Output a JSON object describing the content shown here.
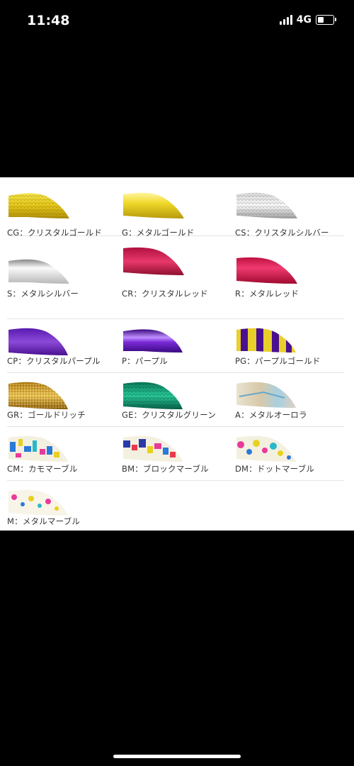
{
  "status": {
    "time": "11:48",
    "network": "4G"
  },
  "colors": [
    {
      "label": "CG：クリスタルゴールド",
      "swatch": "crystal-gold"
    },
    {
      "label": "G：メタルゴールド",
      "swatch": "metal-gold"
    },
    {
      "label": "CS：クリスタルシルバー",
      "swatch": "crystal-silver"
    },
    {
      "label": "S：メタルシルバー",
      "swatch": "metal-silver"
    },
    {
      "label": "CR：クリスタルレッド",
      "swatch": "crystal-red"
    },
    {
      "label": "R：メタルレッド",
      "swatch": "metal-red"
    },
    {
      "label": "CP：クリスタルパープル",
      "swatch": "crystal-purple"
    },
    {
      "label": "P：パープル",
      "swatch": "purple"
    },
    {
      "label": "PG：パープルゴールド",
      "swatch": "purple-gold"
    },
    {
      "label": "GR：ゴールドリッチ",
      "swatch": "gold-rich"
    },
    {
      "label": "GE：クリスタルグリーン",
      "swatch": "crystal-green"
    },
    {
      "label": "A：メタルオーロラ",
      "swatch": "metal-aurora"
    },
    {
      "label": "CM：カモマーブル",
      "swatch": "camo-marble"
    },
    {
      "label": "BM：ブロックマーブル",
      "swatch": "block-marble"
    },
    {
      "label": "DM：ドットマーブル",
      "swatch": "dot-marble"
    },
    {
      "label": "M：メタルマーブル",
      "swatch": "metal-marble"
    }
  ]
}
